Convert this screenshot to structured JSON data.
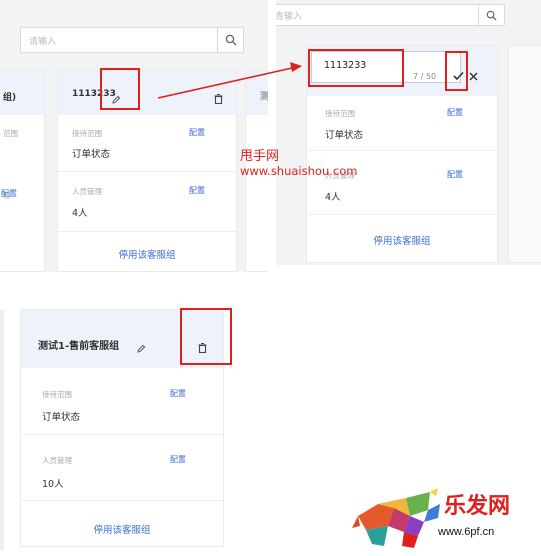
{
  "panel_a": {
    "search_placeholder": "请输入",
    "left_card": {
      "title_fragment": "组)",
      "label_fragment_1": "范围",
      "label_fragment_2": "理",
      "link_fragment": "配置"
    },
    "card": {
      "title": "1113233",
      "scope_label": "接待范围",
      "scope_link": "配置",
      "scope_value": "订单状态",
      "staff_label": "人员管理",
      "staff_link": "配置",
      "staff_value": "4人",
      "disable_link": "停用该客服组"
    },
    "right_fragment": "测"
  },
  "panel_b": {
    "search_placeholder_fragment": "青输入",
    "card": {
      "name_input_value": "1113233",
      "char_count": "7 / 50",
      "scope_label": "接待范围",
      "scope_link": "配置",
      "scope_value": "订单状态",
      "staff_label": "人员管理",
      "staff_link": "配置",
      "staff_value": "4人",
      "disable_link": "停用该客服组"
    }
  },
  "watermark": {
    "line1": "甩手网",
    "line2": "www.shuaishou.com"
  },
  "panel_c": {
    "card": {
      "title": "测试1-售前客服组",
      "scope_label": "接待范围",
      "scope_link": "配置",
      "scope_value": "订单状态",
      "staff_label": "人员管理",
      "staff_link": "配置",
      "staff_value": "10人",
      "disable_link": "停用该客服组"
    }
  },
  "logo": {
    "name": "乐发网",
    "url": "www.6pf.cn"
  },
  "colors": {
    "accent": "#3d6bd8",
    "highlight": "#e0201c",
    "card_header": "#eef2fb"
  }
}
